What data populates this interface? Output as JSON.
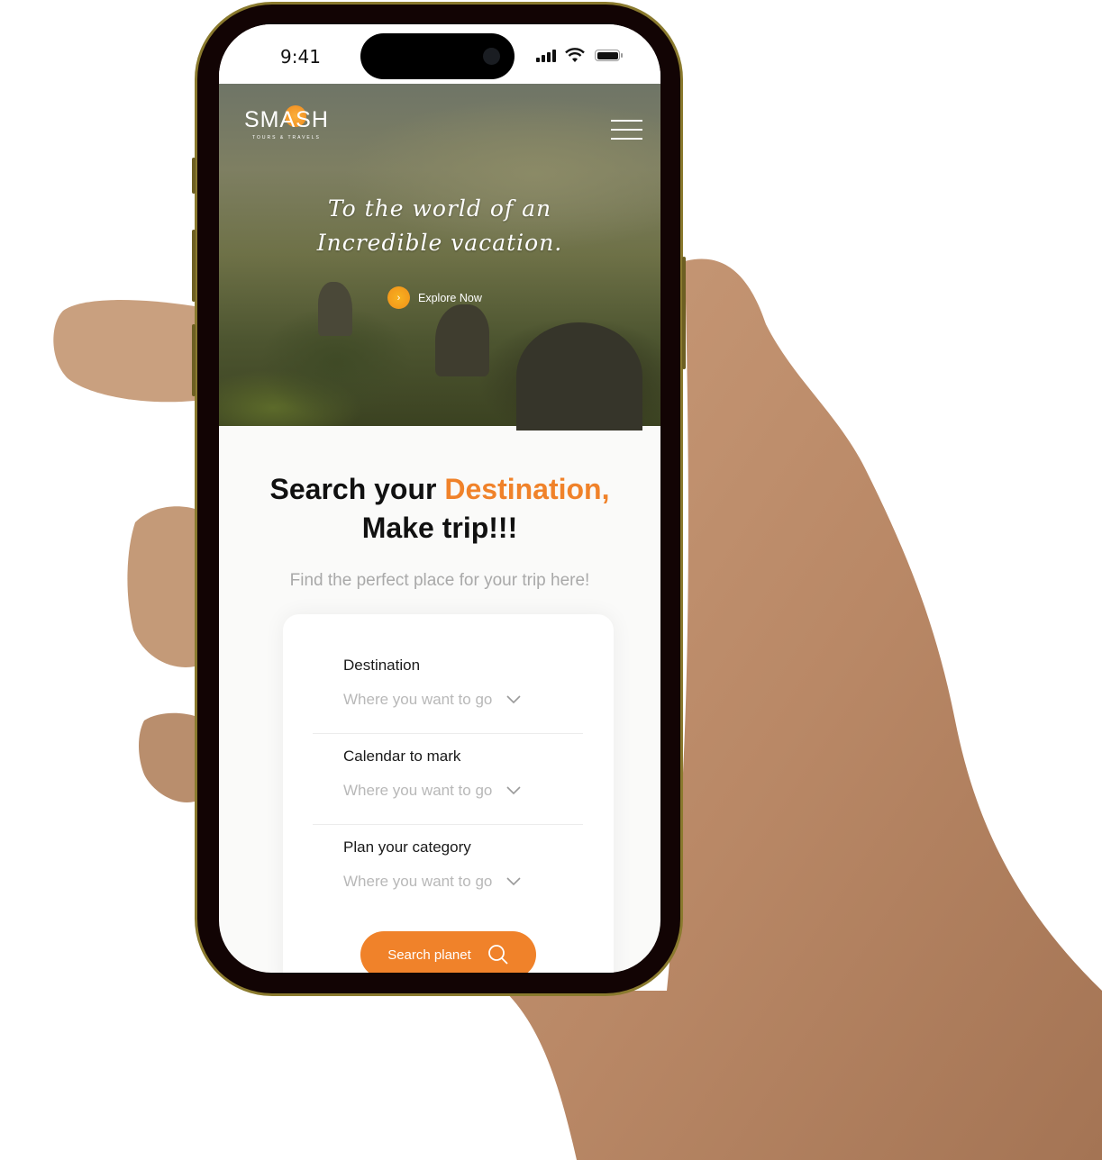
{
  "status_bar": {
    "time": "9:41"
  },
  "hero": {
    "brand_name": "SMASH",
    "brand_tagline": "TOURS & TRAVELS",
    "headline_line1": "To the world of an",
    "headline_line2": "Incredible vacation.",
    "cta_label": "Explore Now",
    "cta_icon": "chevron-right"
  },
  "search_section": {
    "title_prefix": "Search your ",
    "title_accent": "Destination,",
    "title_line2": "Make trip!!!",
    "subtitle": "Find the perfect place for your trip here!",
    "accent_color": "#f0822a",
    "fields": [
      {
        "label": "Destination",
        "placeholder": "Where you want to go"
      },
      {
        "label": "Calendar to mark",
        "placeholder": "Where you want to go"
      },
      {
        "label": "Plan your category",
        "placeholder": "Where you want to go"
      }
    ],
    "search_button_label": "Search planet"
  }
}
